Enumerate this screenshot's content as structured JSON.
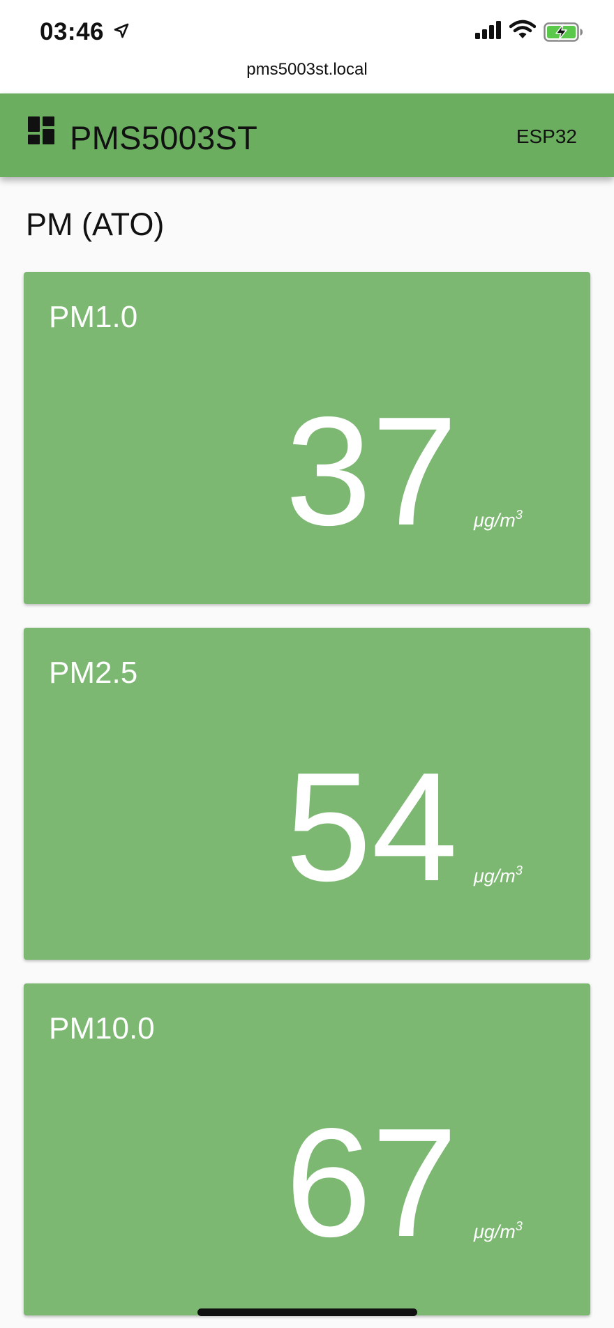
{
  "status_bar": {
    "time": "03:46",
    "url": "pms5003st.local"
  },
  "app_bar": {
    "title": "PMS5003ST",
    "chip": "ESP32",
    "icon": "dashboard-icon"
  },
  "section": {
    "title": "PM (ATO)"
  },
  "cards": [
    {
      "label": "PM1.0",
      "value": "37",
      "unit": "μg/m",
      "unit_exp": "3"
    },
    {
      "label": "PM2.5",
      "value": "54",
      "unit": "μg/m",
      "unit_exp": "3"
    },
    {
      "label": "PM10.0",
      "value": "67",
      "unit": "μg/m",
      "unit_exp": "3"
    }
  ],
  "colors": {
    "app_bar": "#6bae60",
    "card": "#7cb872",
    "background": "#fafafa"
  }
}
